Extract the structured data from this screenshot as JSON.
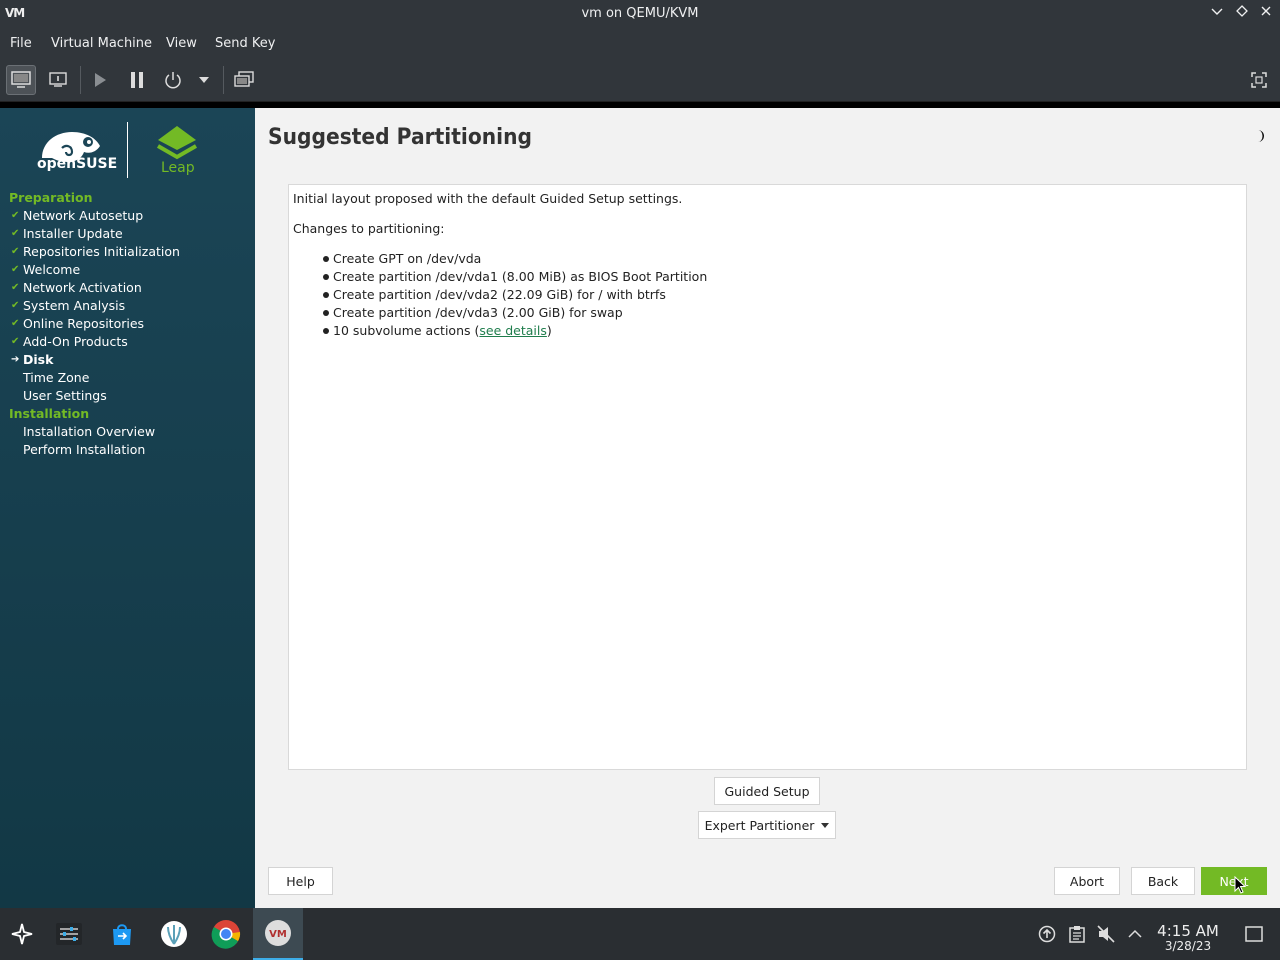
{
  "window": {
    "title": "vm on QEMU/KVM",
    "logo": "VM"
  },
  "menubar": {
    "items": [
      "File",
      "Virtual Machine",
      "View",
      "Send Key"
    ]
  },
  "toolbar": {
    "icons": [
      "console-icon",
      "details-icon",
      "run-icon",
      "pause-icon",
      "power-icon",
      "dropdown-icon",
      "snapshots-icon",
      "fullscreen-icon"
    ]
  },
  "sidebar": {
    "brand": {
      "opensuse": "openSUSE",
      "leap": "Leap"
    },
    "sections": [
      {
        "title": "Preparation",
        "steps": [
          {
            "label": "Network Autosetup",
            "state": "done"
          },
          {
            "label": "Installer Update",
            "state": "done"
          },
          {
            "label": "Repositories Initialization",
            "state": "done"
          },
          {
            "label": "Welcome",
            "state": "done"
          },
          {
            "label": "Network Activation",
            "state": "done"
          },
          {
            "label": "System Analysis",
            "state": "done"
          },
          {
            "label": "Online Repositories",
            "state": "done"
          },
          {
            "label": "Add-On Products",
            "state": "done"
          },
          {
            "label": "Disk",
            "state": "current"
          },
          {
            "label": "Time Zone",
            "state": "todo"
          },
          {
            "label": "User Settings",
            "state": "todo"
          }
        ]
      },
      {
        "title": "Installation",
        "steps": [
          {
            "label": "Installation Overview",
            "state": "todo"
          },
          {
            "label": "Perform Installation",
            "state": "todo"
          }
        ]
      }
    ]
  },
  "main": {
    "title": "Suggested Partitioning",
    "intro": "Initial layout proposed with the default Guided Setup settings.",
    "changes_heading": "Changes to partitioning:",
    "changes": [
      "Create GPT on /dev/vda",
      "Create partition /dev/vda1 (8.00 MiB) as BIOS Boot Partition",
      "Create partition /dev/vda2 (22.09 GiB) for / with btrfs",
      "Create partition /dev/vda3 (2.00 GiB) for swap"
    ],
    "subvolume_prefix": "10 subvolume actions (",
    "subvolume_link": "see details",
    "subvolume_suffix": ")",
    "guided_setup": "Guided Setup",
    "expert_partitioner": "Expert Partitioner",
    "help": "Help",
    "abort": "Abort",
    "back": "Back",
    "next": "Next"
  },
  "colors": {
    "accent": "#73ba25",
    "sidebar": "#173f4f",
    "link": "#1f7d4c"
  },
  "taskbar": {
    "apps": [
      "app-launcher-icon",
      "system-settings-icon",
      "discover-store-icon",
      "shell-icon",
      "chrome-icon",
      "virt-manager-icon"
    ],
    "tray": [
      "updates-icon",
      "clipboard-icon",
      "volume-muted-icon",
      "expand-tray-icon"
    ],
    "time": "4:15 AM",
    "date": "3/28/23"
  }
}
